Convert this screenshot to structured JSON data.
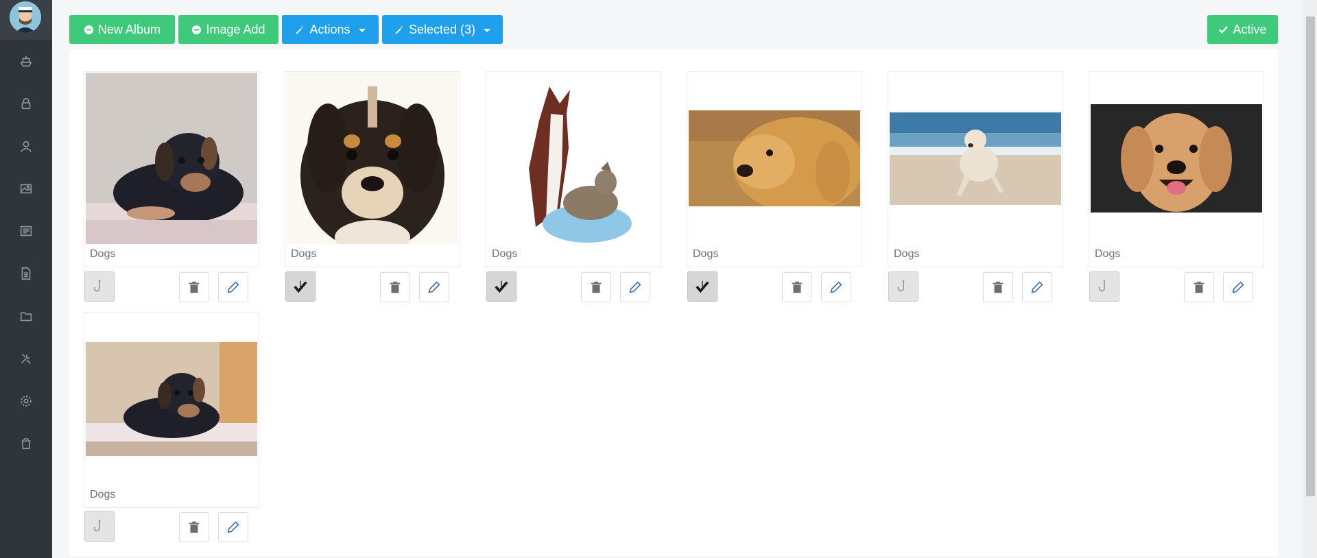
{
  "toolbar": {
    "new_album": "New Album",
    "image_add": "Image Add",
    "actions": "Actions",
    "selected": "Selected (3)",
    "active": "Active"
  },
  "sidebar": {
    "icons": [
      "ship-icon",
      "lock-icon",
      "user-icon",
      "images-icon",
      "newspaper-icon",
      "document-icon",
      "folder-icon",
      "tools-icon",
      "gear-icon",
      "bucket-icon"
    ]
  },
  "gallery": {
    "items": [
      {
        "label": "Dogs",
        "image": "puppy-on-blanket",
        "selected": false
      },
      {
        "label": "Dogs",
        "image": "puppy-closeup",
        "selected": true
      },
      {
        "label": "Dogs",
        "image": "dog-and-cat",
        "selected": true
      },
      {
        "label": "Dogs",
        "image": "golden-retriever-floor",
        "selected": true
      },
      {
        "label": "Dogs",
        "image": "dog-running-beach",
        "selected": false
      },
      {
        "label": "Dogs",
        "image": "golden-retriever-smiling",
        "selected": false
      },
      {
        "label": "Dogs",
        "image": "puppy-on-blanket-wide",
        "selected": false
      }
    ]
  },
  "colors": {
    "green": "#3fc97a",
    "blue": "#1ea0ec",
    "sidebar": "#2f353b"
  }
}
